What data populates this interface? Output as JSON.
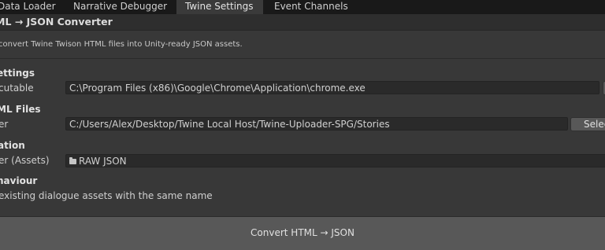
{
  "tabs": [
    {
      "label": "Data Loader",
      "active": false
    },
    {
      "label": "Narrative Debugger",
      "active": false
    },
    {
      "label": "Twine Settings",
      "active": true
    },
    {
      "label": "Event Channels",
      "active": false
    }
  ],
  "header": {
    "title": "ML → JSON Converter"
  },
  "description": "convert Twine Twison HTML files into Unity-ready JSON assets.",
  "sections": {
    "browser": {
      "heading": "ettings",
      "label": "cutable",
      "value": "C:\\Program Files (x86)\\Google\\Chrome\\Application\\chrome.exe"
    },
    "html_files": {
      "heading": "ML Files",
      "label": "er",
      "value": "C:/Users/Alex/Desktop/Twine Local Host/Twine-Uploader-SPG/Stories",
      "button": "Selec"
    },
    "location": {
      "heading": "ation",
      "label": "er (Assets)",
      "folder_icon": "folder-icon",
      "value": "RAW JSON"
    },
    "behaviour": {
      "heading": "haviour",
      "option": "existing dialogue assets with the same name"
    }
  },
  "footer": {
    "convert_label": "Convert HTML → JSON"
  },
  "colors": {
    "background": "#383838",
    "tabbar": "#191919",
    "field": "#2a2a2a",
    "button": "#585858"
  }
}
